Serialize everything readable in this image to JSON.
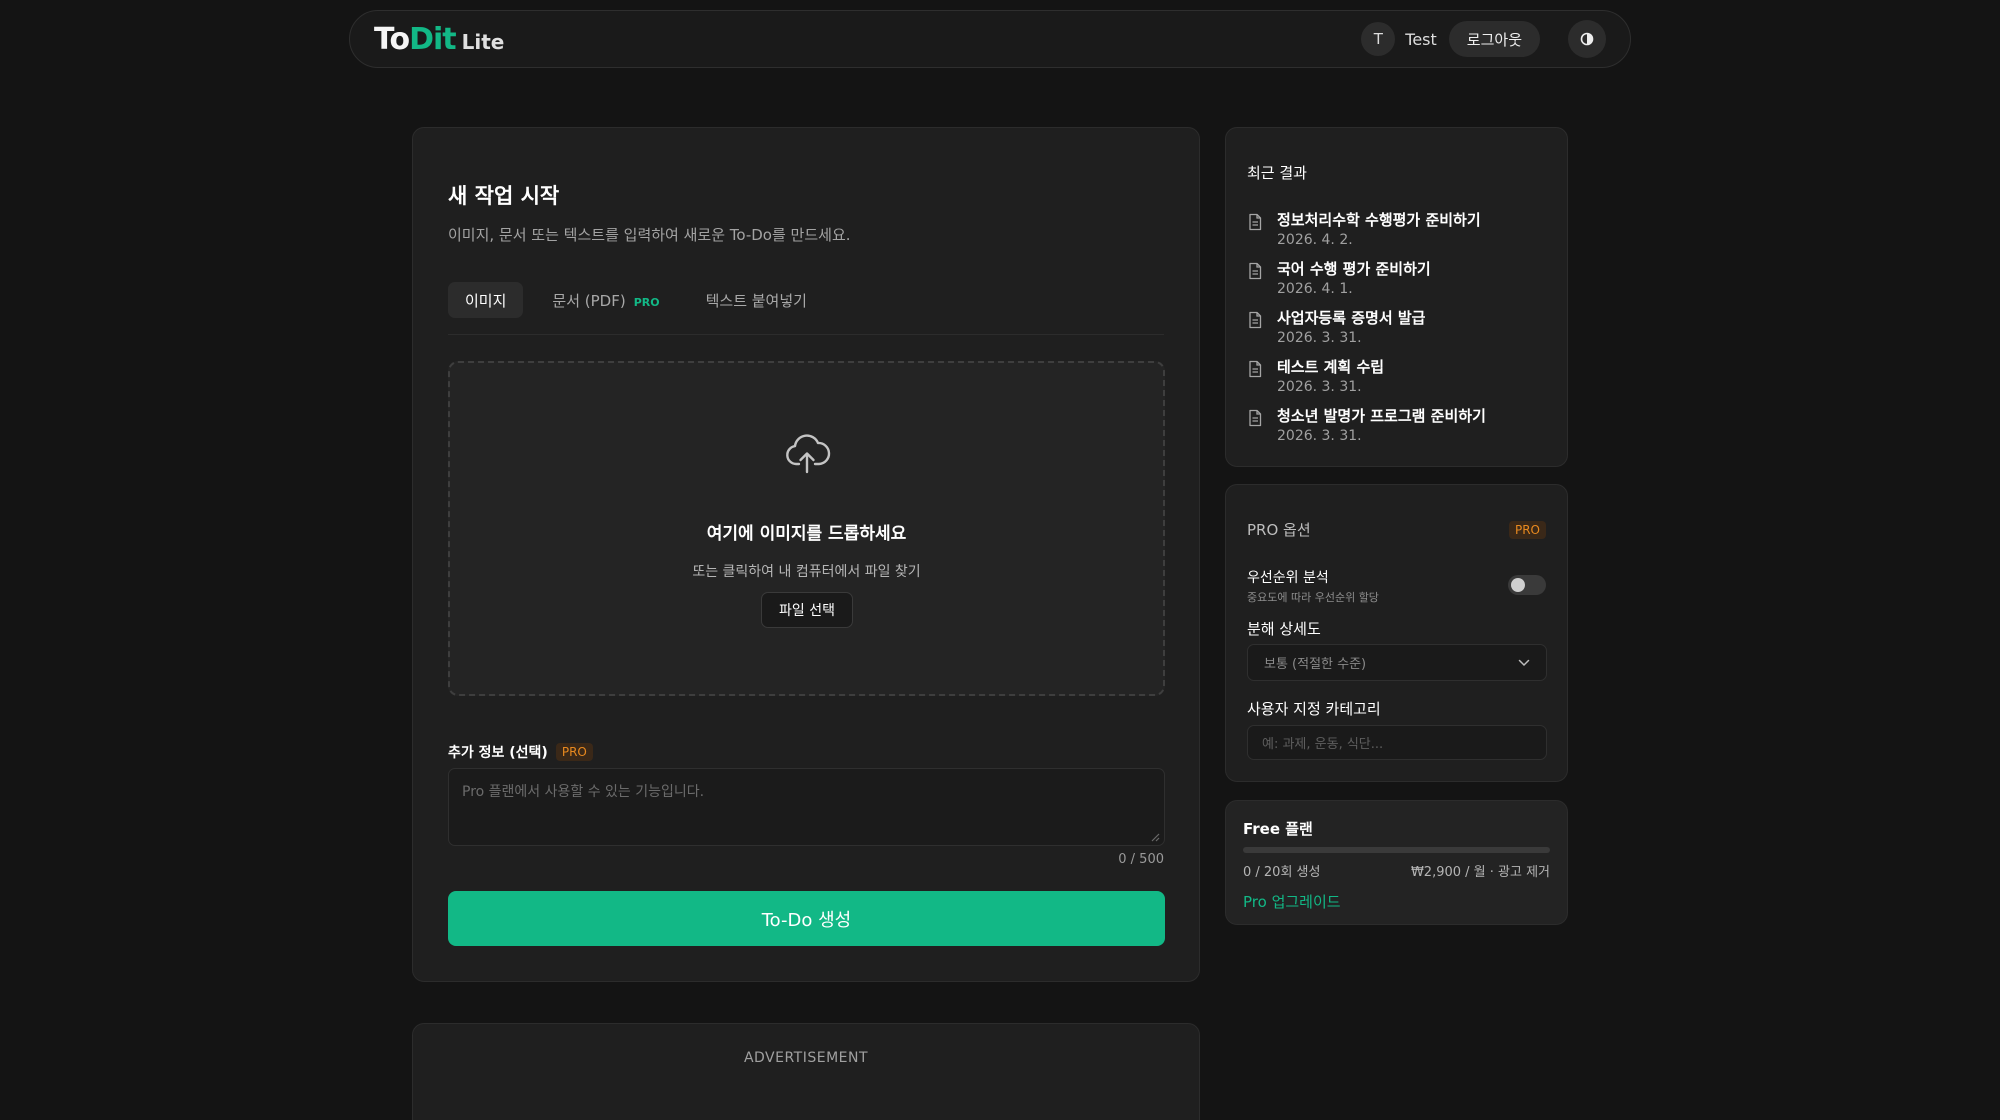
{
  "header": {
    "logo": {
      "to": "To",
      "dit": "Dit",
      "lite": "Lite"
    },
    "avatar_initial": "T",
    "username": "Test",
    "logout_label": "로그아웃",
    "theme_icon": "contrast-icon"
  },
  "main": {
    "title": "새 작업 시작",
    "subtitle": "이미지, 문서 또는 텍스트를 입력하여 새로운 To-Do를 만드세요.",
    "tabs": [
      {
        "label": "이미지",
        "active": true,
        "badge": ""
      },
      {
        "label": "문서 (PDF)",
        "active": false,
        "badge": "PRO"
      },
      {
        "label": "텍스트 붙여넣기",
        "active": false,
        "badge": ""
      }
    ],
    "dropzone": {
      "icon": "cloud-upload-icon",
      "title": "여기에 이미지를 드롭하세요",
      "subtitle": "또는 클릭하여 내 컴퓨터에서 파일 찾기",
      "button_label": "파일 선택"
    },
    "extra_info": {
      "label": "추가 정보 (선택)",
      "badge": "PRO",
      "placeholder": "Pro 플랜에서 사용할 수 있는 기능입니다.",
      "char_count": "0 / 500"
    },
    "generate_label": "To-Do 생성"
  },
  "ad": {
    "label": "ADVERTISEMENT"
  },
  "recent": {
    "title": "최근 결과",
    "items": [
      {
        "title": "정보처리수학 수행평가 준비하기",
        "date": "2026. 4. 2."
      },
      {
        "title": "국어 수행 평가 준비하기",
        "date": "2026. 4. 1."
      },
      {
        "title": "사업자등록 증명서 발급",
        "date": "2026. 3. 31."
      },
      {
        "title": "테스트 계획 수립",
        "date": "2026. 3. 31."
      },
      {
        "title": "청소년 발명가 프로그램 준비하기",
        "date": "2026. 3. 31."
      }
    ]
  },
  "pro_options": {
    "title": "PRO 옵션",
    "badge": "PRO",
    "priority_label": "우선순위 분석",
    "priority_desc": "중요도에 따라 우선순위 할당",
    "priority_enabled": false,
    "detail_label": "분해 상세도",
    "detail_value": "보통 (적절한 수준)",
    "category_label": "사용자 지정 카테고리",
    "category_placeholder": "예: 과제, 운동, 식단..."
  },
  "plan": {
    "title": "Free 플랜",
    "usage_text": "0 / 20회 생성",
    "usage_fraction": 0,
    "price_text": "₩2,900 / 월 · 광고 제거",
    "upgrade_label": "Pro 업그레이드"
  },
  "colors": {
    "accent": "#12b886",
    "pro_badge": "#e8891f",
    "background": "#141414",
    "card": "#1f1f1f"
  }
}
